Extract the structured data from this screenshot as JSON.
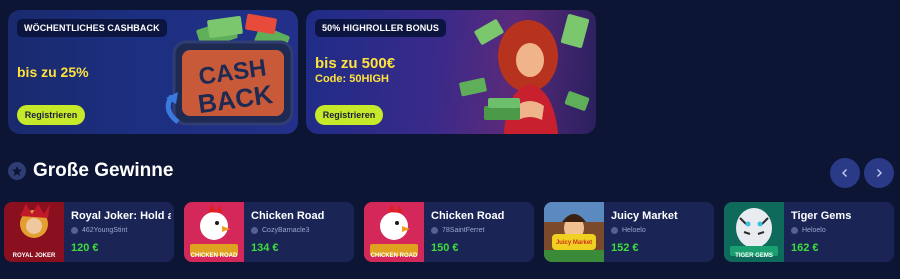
{
  "promos": [
    {
      "badge": "WÖCHENTLICHES CASHBACK",
      "headline": "bis zu 25%",
      "cta": "Registrieren",
      "art_text_1": "CASH",
      "art_text_2": "BACK"
    },
    {
      "badge": "50% HIGHROLLER BONUS",
      "headline": "bis zu 500€",
      "code": "Code: 50HIGH",
      "cta": "Registrieren"
    }
  ],
  "section": {
    "title": "Große Gewinne",
    "icon": "star-icon",
    "prev_icon": "chevron-left-icon",
    "next_icon": "chevron-right-icon"
  },
  "winners": [
    {
      "game": "Royal Joker: Hold a",
      "user": "462YoungStint",
      "amount": "120 €",
      "thumb_text": "ROYAL JOKER",
      "thumb_color": "#c01a2a"
    },
    {
      "game": "Chicken Road",
      "user": "CozyBarnacle3",
      "amount": "134 €",
      "thumb_text": "CHICKEN ROAD",
      "thumb_color": "#d4285a"
    },
    {
      "game": "Chicken Road",
      "user": "78SaintFerret",
      "amount": "150 €",
      "thumb_text": "CHICKEN ROAD",
      "thumb_color": "#d4285a"
    },
    {
      "game": "Juicy Market",
      "user": "Heloelo",
      "amount": "152 €",
      "thumb_text": "Juicy Market",
      "thumb_color": "#a85a2a"
    },
    {
      "game": "Tiger Gems",
      "user": "Heloelo",
      "amount": "162 €",
      "thumb_text": "TIGER GEMS",
      "thumb_color": "#1a8a6a"
    }
  ],
  "colors": {
    "background": "#0d1535",
    "card": "#1a2556",
    "accent_yellow": "#ffe23c",
    "cta_green": "#c6ea2a",
    "amount_green": "#3ddc3d",
    "nav_button": "#2b3a86"
  }
}
